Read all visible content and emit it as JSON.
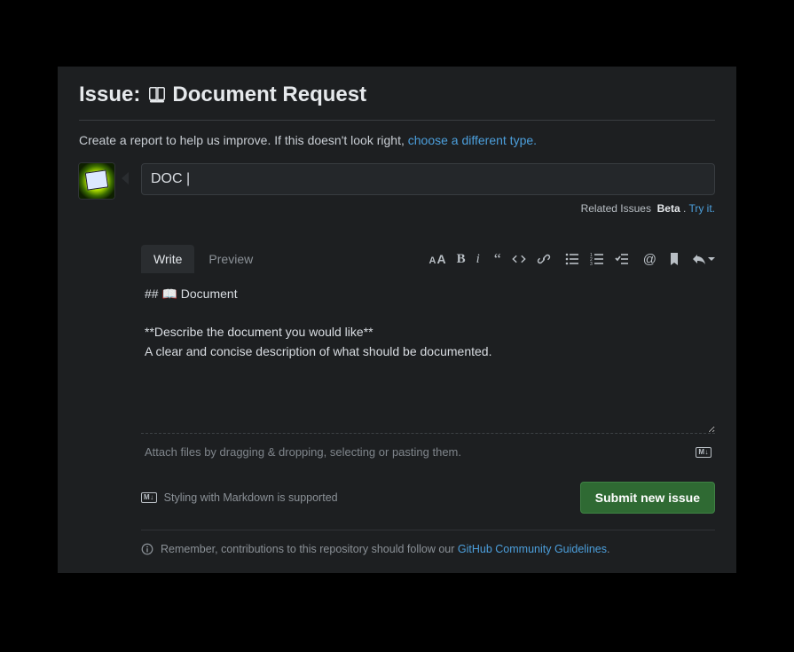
{
  "header": {
    "prefix": "Issue:",
    "title": "Document Request"
  },
  "subtitle": {
    "text": "Create a report to help us improve. If this doesn't look right, ",
    "link": "choose a different type."
  },
  "title_input": {
    "value": "DOC |"
  },
  "related": {
    "label": "Related Issues",
    "beta": "Beta",
    "dot": " . ",
    "try": "Try it."
  },
  "tabs": {
    "write": "Write",
    "preview": "Preview"
  },
  "body_template": "## 📖 Document\n\n**Describe the document you would like**\nA clear and concise description of what should be documented.",
  "attach_hint": "Attach files by dragging & dropping, selecting or pasting them.",
  "md_badge": "M↓",
  "md_hint": "Styling with Markdown is supported",
  "submit_label": "Submit new issue",
  "guidelines": {
    "text": "Remember, contributions to this repository should follow our ",
    "link": "GitHub Community Guidelines",
    "dot": "."
  }
}
